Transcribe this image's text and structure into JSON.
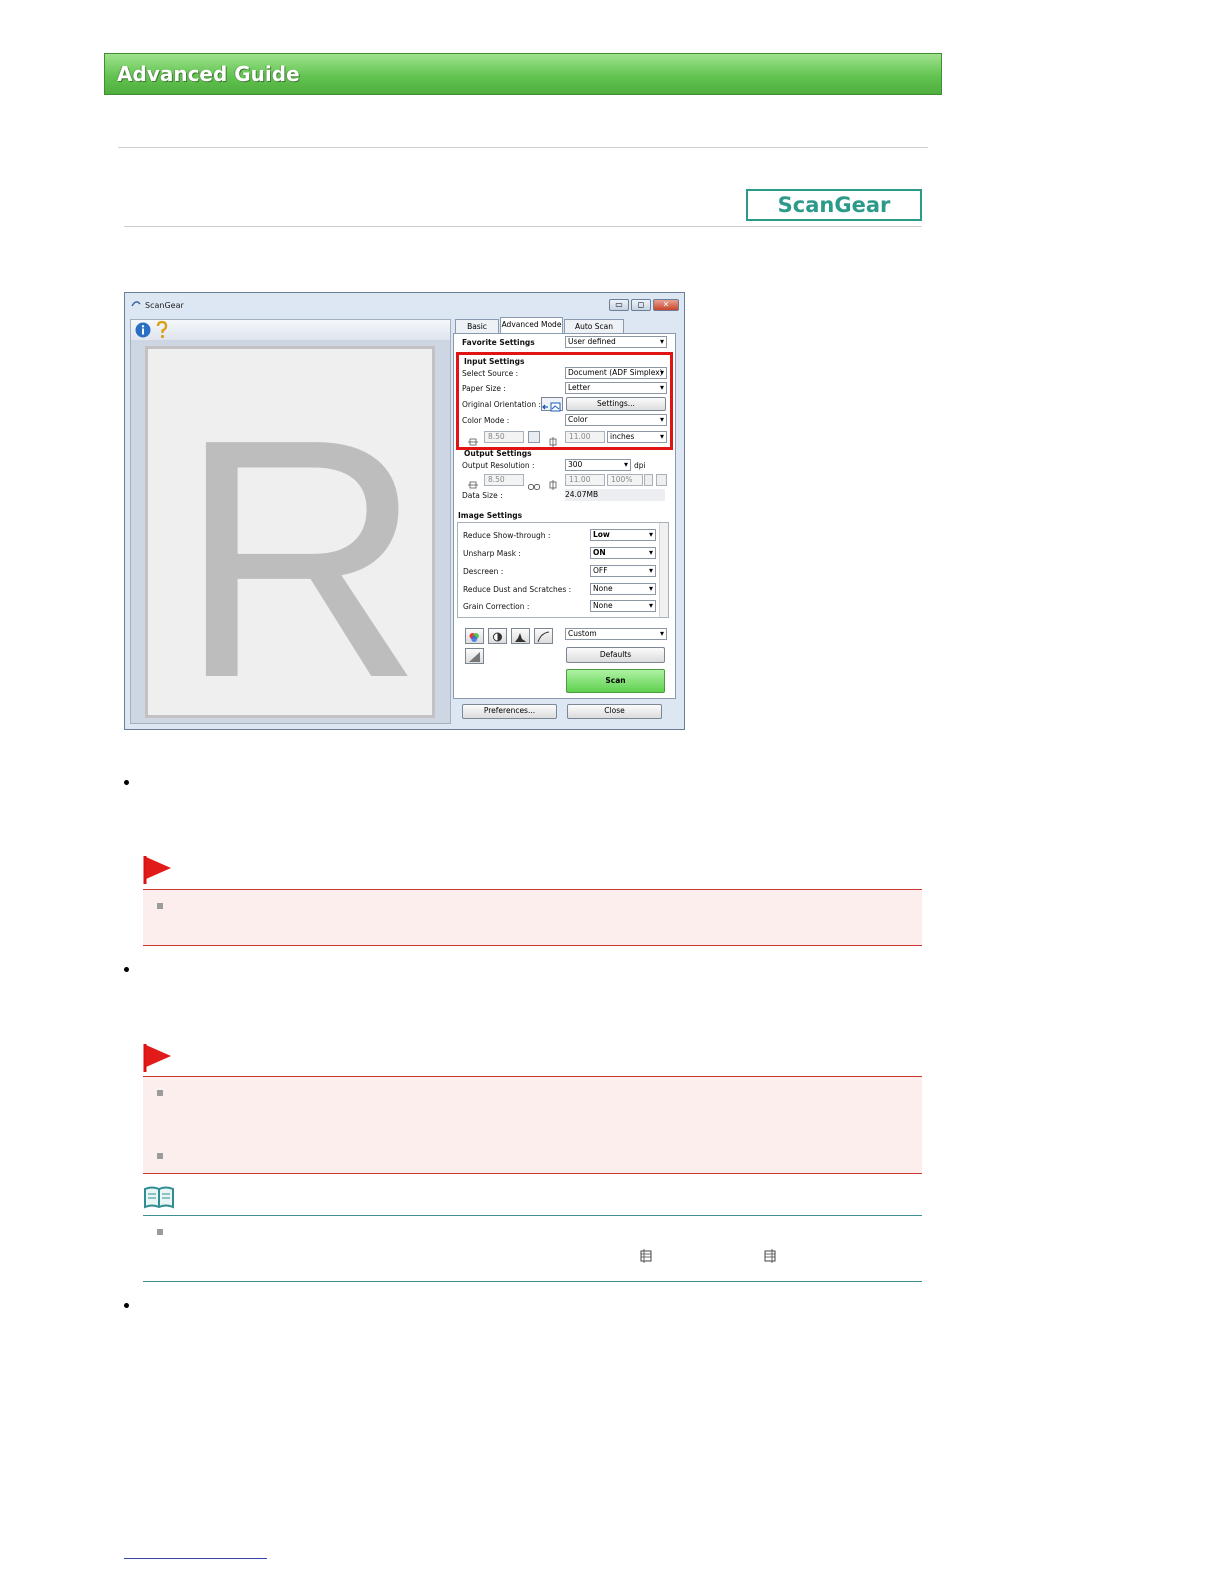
{
  "header": {
    "title": "Advanced Guide"
  },
  "badge": {
    "label": "ScanGear"
  },
  "window": {
    "title": "ScanGear",
    "controls": {
      "minimize": "▭",
      "maximize": "◻",
      "close": "✕"
    },
    "preview_letter": "R",
    "tabs": [
      {
        "label": "Basic Mode"
      },
      {
        "label": "Advanced Mode"
      },
      {
        "label": "Auto Scan Mode"
      }
    ],
    "favorite": {
      "label": "Favorite Settings",
      "value": "User defined"
    },
    "input": {
      "heading": "Input Settings",
      "select_source_label": "Select Source :",
      "select_source_value": "Document (ADF Simplex)",
      "paper_size_label": "Paper Size :",
      "paper_size_value": "Letter",
      "orientation_label": "Original Orientation :",
      "settings_button": "Settings...",
      "color_mode_label": "Color Mode :",
      "color_mode_value": "Color",
      "width": "8.50",
      "height": "11.00",
      "unit": "inches"
    },
    "output": {
      "heading": "Output Settings",
      "resolution_label": "Output Resolution :",
      "resolution_value": "300",
      "dpi": "dpi",
      "width": "8.50",
      "height": "11.00",
      "scale": "100%",
      "data_size_label": "Data Size :",
      "data_size_value": "24.07MB"
    },
    "image": {
      "heading": "Image Settings",
      "rows": [
        {
          "label": "Reduce Show-through :",
          "value": "Low"
        },
        {
          "label": "Unsharp Mask :",
          "value": "ON"
        },
        {
          "label": "Descreen :",
          "value": "OFF"
        },
        {
          "label": "Reduce Dust and Scratches :",
          "value": "None"
        },
        {
          "label": "Grain Correction :",
          "value": "None"
        }
      ]
    },
    "tone": {
      "value": "Custom",
      "defaults_button": "Defaults"
    },
    "scan_button": "Scan",
    "preferences_button": "Preferences...",
    "close_button": "Close"
  },
  "colors": {
    "banner": "#63c451",
    "badge": "#2c9a8a",
    "important": "#c8382f",
    "note": "#3e8f94",
    "highlight": "#e01414"
  }
}
